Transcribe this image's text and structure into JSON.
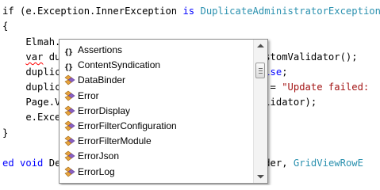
{
  "editor": {
    "lines": [
      {
        "segments": [
          {
            "text": "if (e.Exception.InnerException ",
            "cls": ""
          },
          {
            "text": "is",
            "cls": "kw"
          },
          {
            "text": " ",
            "cls": ""
          },
          {
            "text": "DuplicateAdministratorException",
            "cls": "ty"
          },
          {
            "text": ")",
            "cls": ""
          }
        ]
      },
      {
        "segments": [
          {
            "text": "{",
            "cls": ""
          }
        ]
      },
      {
        "segments": [
          {
            "text": "    Elmah.",
            "cls": ""
          }
        ]
      },
      {
        "segments": [
          {
            "text": "    ",
            "cls": ""
          },
          {
            "text": "var",
            "cls": "squig"
          },
          {
            "text": " du",
            "cls": ""
          },
          {
            "text": "                                  ustomValidator();",
            "cls": ""
          }
        ]
      },
      {
        "segments": [
          {
            "text": "    duplic",
            "cls": ""
          },
          {
            "text": "                                  ",
            "cls": ""
          },
          {
            "text": "alse",
            "cls": "kw"
          },
          {
            "text": ";",
            "cls": ""
          }
        ]
      },
      {
        "segments": [
          {
            "text": "    duplic",
            "cls": ""
          },
          {
            "text": "                                  e = ",
            "cls": ""
          },
          {
            "text": "\"Update failed:",
            "cls": "str"
          }
        ]
      },
      {
        "segments": [
          {
            "text": "    Page.V",
            "cls": ""
          },
          {
            "text": "                                  alidator);",
            "cls": ""
          }
        ]
      },
      {
        "segments": [
          {
            "text": "    e.Excep",
            "cls": ""
          }
        ]
      },
      {
        "segments": [
          {
            "text": "}",
            "cls": ""
          }
        ]
      },
      {
        "segments": [
          {
            "text": "",
            "cls": ""
          }
        ]
      },
      {
        "segments": [
          {
            "text": "ed",
            "cls": "kw"
          },
          {
            "text": " ",
            "cls": ""
          },
          {
            "text": "void",
            "cls": "kw"
          },
          {
            "text": " Dep",
            "cls": ""
          },
          {
            "text": "                               sender, ",
            "cls": ""
          },
          {
            "text": "GridViewRowE",
            "cls": "ty"
          }
        ]
      }
    ]
  },
  "intellisense": {
    "items": [
      {
        "label": "Assertions",
        "icon": "namespace-icon"
      },
      {
        "label": "ContentSyndication",
        "icon": "namespace-icon"
      },
      {
        "label": "DataBinder",
        "icon": "class-icon"
      },
      {
        "label": "Error",
        "icon": "class-icon"
      },
      {
        "label": "ErrorDisplay",
        "icon": "class-icon"
      },
      {
        "label": "ErrorFilterConfiguration",
        "icon": "class-icon"
      },
      {
        "label": "ErrorFilterModule",
        "icon": "class-icon"
      },
      {
        "label": "ErrorJson",
        "icon": "class-icon"
      },
      {
        "label": "ErrorLog",
        "icon": "class-icon"
      }
    ],
    "namespace_glyph": "{}",
    "scroll_fraction": 0.1
  },
  "colors": {
    "keyword": "#0000ff",
    "type": "#2b91af",
    "string": "#a31515",
    "class_icon_orange": "#e8a33d",
    "class_icon_purple": "#8a5fc4"
  }
}
